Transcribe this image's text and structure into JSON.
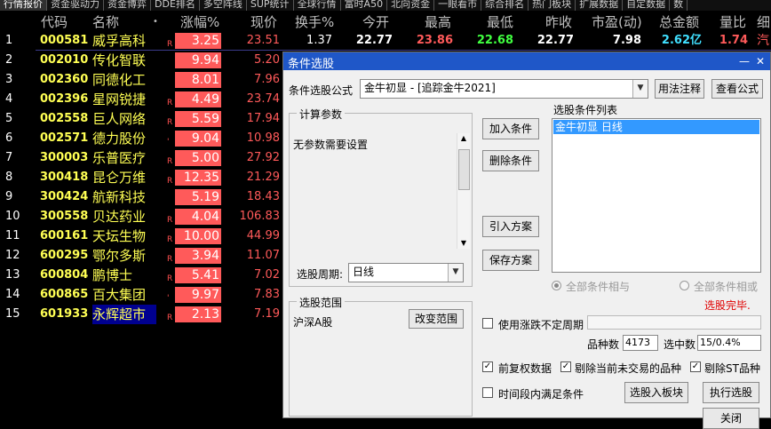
{
  "tabs": [
    "行情报价",
    "资金驱动力",
    "资金博弈",
    "DDE排名",
    "多空阵线",
    "SUP统计",
    "全球行情",
    "富时A50",
    "北向资金",
    "一眼看市",
    "综合排名",
    "热门板块",
    "扩展数据",
    "自定数据",
    "数"
  ],
  "columns": {
    "code": "代码",
    "name": "名称",
    "star": "•",
    "pct": "涨幅%",
    "price": "现价",
    "turnover": "换手%",
    "open": "今开",
    "high": "最高",
    "low": "最低",
    "prev": "昨收",
    "pe": "市盈(动)",
    "amount": "总金额",
    "vol_ratio": "量比",
    "industry": "细"
  },
  "top_row": {
    "idx": "1",
    "code": "000581",
    "name": "威孚高科",
    "mark": "R",
    "pct": "3.25",
    "price": "23.51",
    "turnover": "1.37",
    "open": "22.77",
    "high": "23.86",
    "low": "22.68",
    "prev": "22.77",
    "pe": "7.98",
    "amount": "2.62亿",
    "vol_ratio": "1.74",
    "industry": "汽"
  },
  "rows": [
    {
      "idx": "2",
      "code": "002010",
      "name": "传化智联",
      "mark": "",
      "pct": "9.94",
      "price": "5.20"
    },
    {
      "idx": "3",
      "code": "002360",
      "name": "同德化工",
      "mark": "",
      "pct": "8.01",
      "price": "7.96"
    },
    {
      "idx": "4",
      "code": "002396",
      "name": "星网锐捷",
      "mark": "R",
      "pct": "4.49",
      "price": "23.74"
    },
    {
      "idx": "5",
      "code": "002558",
      "name": "巨人网络",
      "mark": "R",
      "pct": "5.59",
      "price": "17.94"
    },
    {
      "idx": "6",
      "code": "002571",
      "name": "德力股份",
      "mark": "'",
      "pct": "9.04",
      "price": "10.98"
    },
    {
      "idx": "7",
      "code": "300003",
      "name": "乐普医疗",
      "mark": "R",
      "pct": "5.00",
      "price": "27.92"
    },
    {
      "idx": "8",
      "code": "300418",
      "name": "昆仑万维",
      "mark": "R",
      "pct": "12.35",
      "price": "21.29"
    },
    {
      "idx": "9",
      "code": "300424",
      "name": "航新科技",
      "mark": "",
      "pct": "5.19",
      "price": "18.43"
    },
    {
      "idx": "10",
      "code": "300558",
      "name": "贝达药业",
      "mark": "R",
      "pct": "4.04",
      "price": "106.83"
    },
    {
      "idx": "11",
      "code": "600161",
      "name": "天坛生物",
      "mark": "R",
      "pct": "10.00",
      "price": "44.99"
    },
    {
      "idx": "12",
      "code": "600295",
      "name": "鄂尔多斯",
      "mark": "R",
      "pct": "3.94",
      "price": "11.07"
    },
    {
      "idx": "13",
      "code": "600804",
      "name": "鹏博士",
      "mark": "R",
      "pct": "5.41",
      "price": "7.02"
    },
    {
      "idx": "14",
      "code": "600865",
      "name": "百大集团",
      "mark": "'",
      "pct": "9.97",
      "price": "7.83"
    },
    {
      "idx": "15",
      "code": "601933",
      "name": "永辉超市",
      "mark": "R",
      "pct": "2.13",
      "price": "7.19"
    }
  ],
  "dialog": {
    "title": "条件选股",
    "formula_label": "条件选股公式",
    "formula_value": "金牛初显      - [追踪金牛2021]",
    "usage_button": "用法注释",
    "view_formula_button": "查看公式",
    "calc_params_title": "计算参数",
    "no_params_text": "无参数需要设置",
    "period_label": "选股周期:",
    "period_value": "日线",
    "add_condition": "加入条件",
    "delete_condition": "删除条件",
    "load_plan": "引入方案",
    "save_plan": "保存方案",
    "condition_list_title": "选股条件列表",
    "condition_item": "金牛初显    日线",
    "radio_and": "全部条件相与",
    "radio_or": "全部条件相或",
    "status": "选股完毕.",
    "scope_title": "选股范围",
    "scope_value": "沪深A股",
    "change_scope": "改变范围",
    "use_volatile_period": "使用涨跌不定周期",
    "count_label": "品种数",
    "count_value": "4173",
    "selected_label": "选中数",
    "selected_value": "15/0.4%",
    "pre_adjust": "前复权数据",
    "exclude_suspended": "剔除当前未交易的品种",
    "exclude_st": "剔除ST品种",
    "time_range": "时间段内满足条件",
    "to_board": "选股入板块",
    "execute": "执行选股",
    "close": "关闭"
  }
}
